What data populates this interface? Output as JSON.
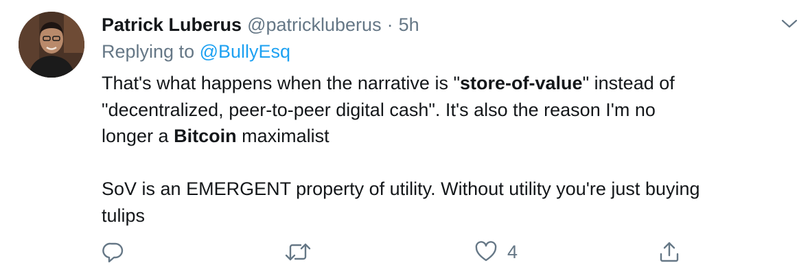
{
  "author": {
    "name": "Patrick Luberus",
    "handle": "@patrickluberus",
    "separator": "·",
    "time": "5h"
  },
  "reply": {
    "prefix": "Replying to",
    "mention": "@BullyEsq"
  },
  "body": {
    "l1_a": "That's what happens when the narrative is \"",
    "l1_b": "store-of-value",
    "l1_c": "\" instead of",
    "l2": "\"decentralized, peer-to-peer digital cash\". It's also the reason I'm no",
    "l3_a": "longer a ",
    "l3_b": "Bitcoin",
    "l3_c": " maximalist",
    "l4": "SoV is an EMERGENT property of utility. Without utility you're just buying",
    "l5": "tulips"
  },
  "actions": {
    "like_count": "4"
  },
  "icons": {
    "menu": "chevron-down-icon",
    "reply": "reply-icon",
    "retweet": "retweet-icon",
    "like": "heart-icon",
    "share": "share-icon"
  },
  "colors": {
    "text": "#14171a",
    "muted": "#657786",
    "link": "#1da1f2"
  }
}
